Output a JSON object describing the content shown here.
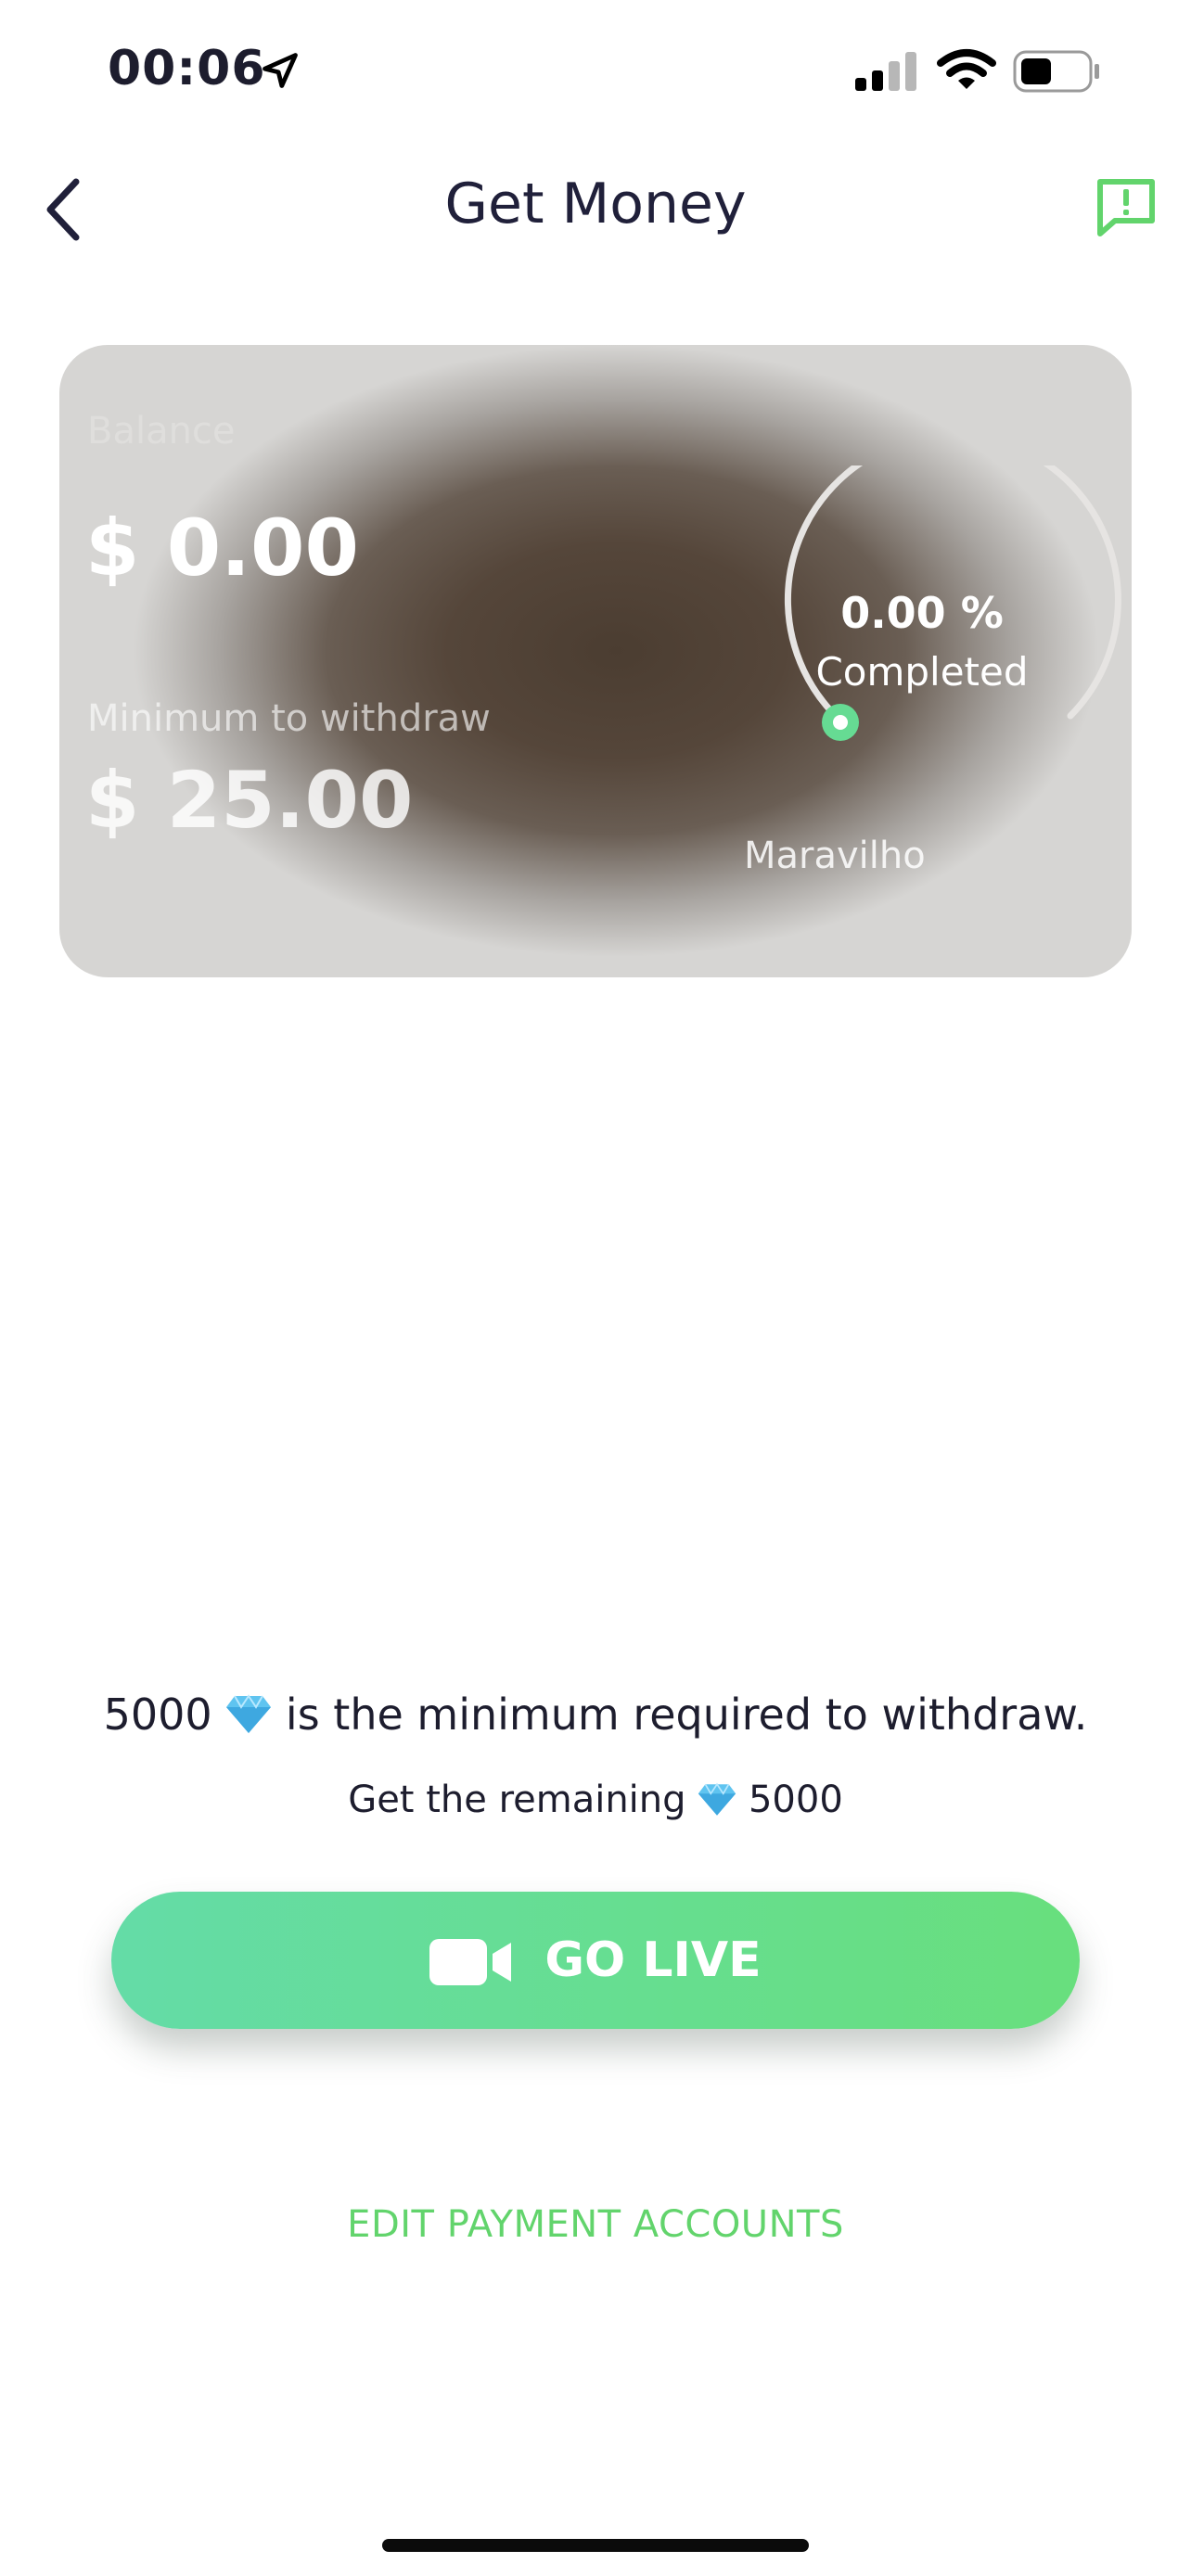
{
  "status_bar": {
    "time": "00:06",
    "icons": [
      "location-arrow-icon",
      "cellular-signal-icon",
      "wifi-icon",
      "battery-icon"
    ]
  },
  "header": {
    "title": "Get Money",
    "back_icon": "chevron-left-icon",
    "report_icon": "report-message-icon"
  },
  "card": {
    "balance_label": "Balance",
    "balance_value": "$ 0.00",
    "min_withdraw_label": "Minimum to withdraw",
    "min_withdraw_value": "$ 25.00",
    "progress_text": "0.00 %",
    "progress_fraction": 0,
    "progress_caption": "Completed",
    "username": "Maravilho"
  },
  "info": {
    "min_amount": "5000",
    "min_text": "is the minimum required to withdraw.",
    "remaining_prefix": "Get the remaining",
    "remaining_amount": "5000"
  },
  "actions": {
    "go_live_label": "GO LIVE",
    "edit_payment_label": "EDIT PAYMENT ACCOUNTS"
  },
  "colors": {
    "accent_green": "#62d46c",
    "gradient_start": "#64dca7",
    "gradient_end": "#68df7d",
    "title_dark": "#20203a"
  }
}
